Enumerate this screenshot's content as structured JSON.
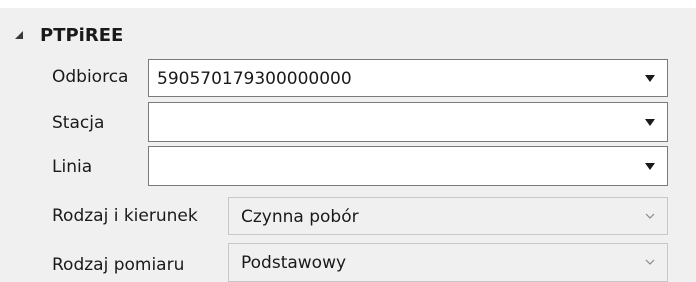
{
  "group": {
    "title": "PTPiREE",
    "expanded": true
  },
  "fields": {
    "odbiorca": {
      "label": "Odbiorca",
      "value": "590570179300000000"
    },
    "stacja": {
      "label": "Stacja",
      "value": ""
    },
    "linia": {
      "label": "Linia",
      "value": ""
    },
    "rodzaj_kierunek": {
      "label": "Rodzaj i kierunek",
      "value": "Czynna pobór",
      "enabled": false
    },
    "rodzaj_pomiaru": {
      "label": "Rodzaj pomiaru",
      "value": "Podstawowy",
      "enabled": false
    }
  },
  "icons": {
    "collapse": "expanded-triangle-icon",
    "dropdown": "dropdown-arrow-icon",
    "chevron": "chevron-down-icon"
  },
  "colors": {
    "panel_background": "#f0f0f0",
    "combo_background": "#ffffff",
    "combo_border": "#7a7a7a",
    "disabled_border": "#c8c8c8"
  }
}
